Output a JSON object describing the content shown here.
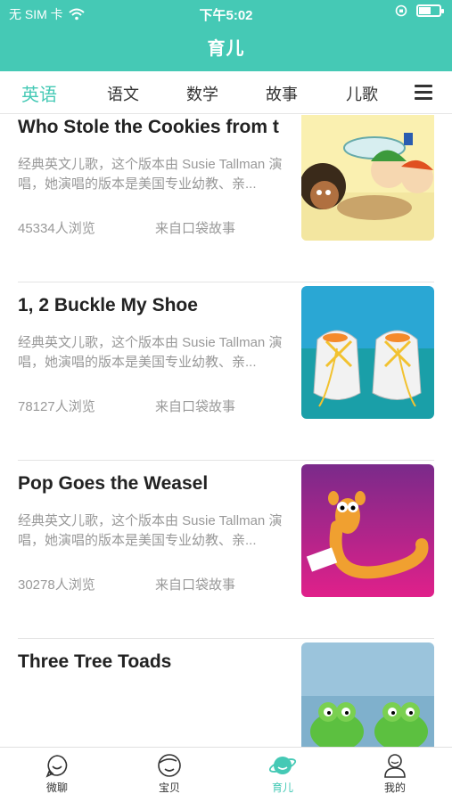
{
  "status": {
    "carrier": "无 SIM 卡",
    "time": "下午5:02"
  },
  "header": {
    "title": "育儿"
  },
  "tabs": [
    "英语",
    "语文",
    "数学",
    "故事",
    "儿歌"
  ],
  "items": [
    {
      "title": "Who Stole the Cookies from t",
      "desc": "经典英文儿歌，这个版本由 Susie Tallman 演唱，她演唱的版本是美国专业幼教、亲...",
      "views": "45334人浏览",
      "source": "来自口袋故事"
    },
    {
      "title": "1, 2 Buckle My Shoe",
      "desc": "经典英文儿歌，这个版本由 Susie Tallman 演唱，她演唱的版本是美国专业幼教、亲...",
      "views": "78127人浏览",
      "source": "来自口袋故事"
    },
    {
      "title": "Pop Goes the Weasel",
      "desc": "经典英文儿歌，这个版本由 Susie Tallman 演唱，她演唱的版本是美国专业幼教、亲...",
      "views": "30278人浏览",
      "source": "来自口袋故事"
    },
    {
      "title": "Three Tree Toads",
      "desc": "",
      "views": "",
      "source": ""
    }
  ],
  "bottom_nav": [
    {
      "label": "微聊",
      "icon": "chat-face-icon"
    },
    {
      "label": "宝贝",
      "icon": "baby-face-icon"
    },
    {
      "label": "育儿",
      "icon": "planet-icon"
    },
    {
      "label": "我的",
      "icon": "profile-icon"
    }
  ],
  "colors": {
    "accent": "#45c9b5"
  }
}
